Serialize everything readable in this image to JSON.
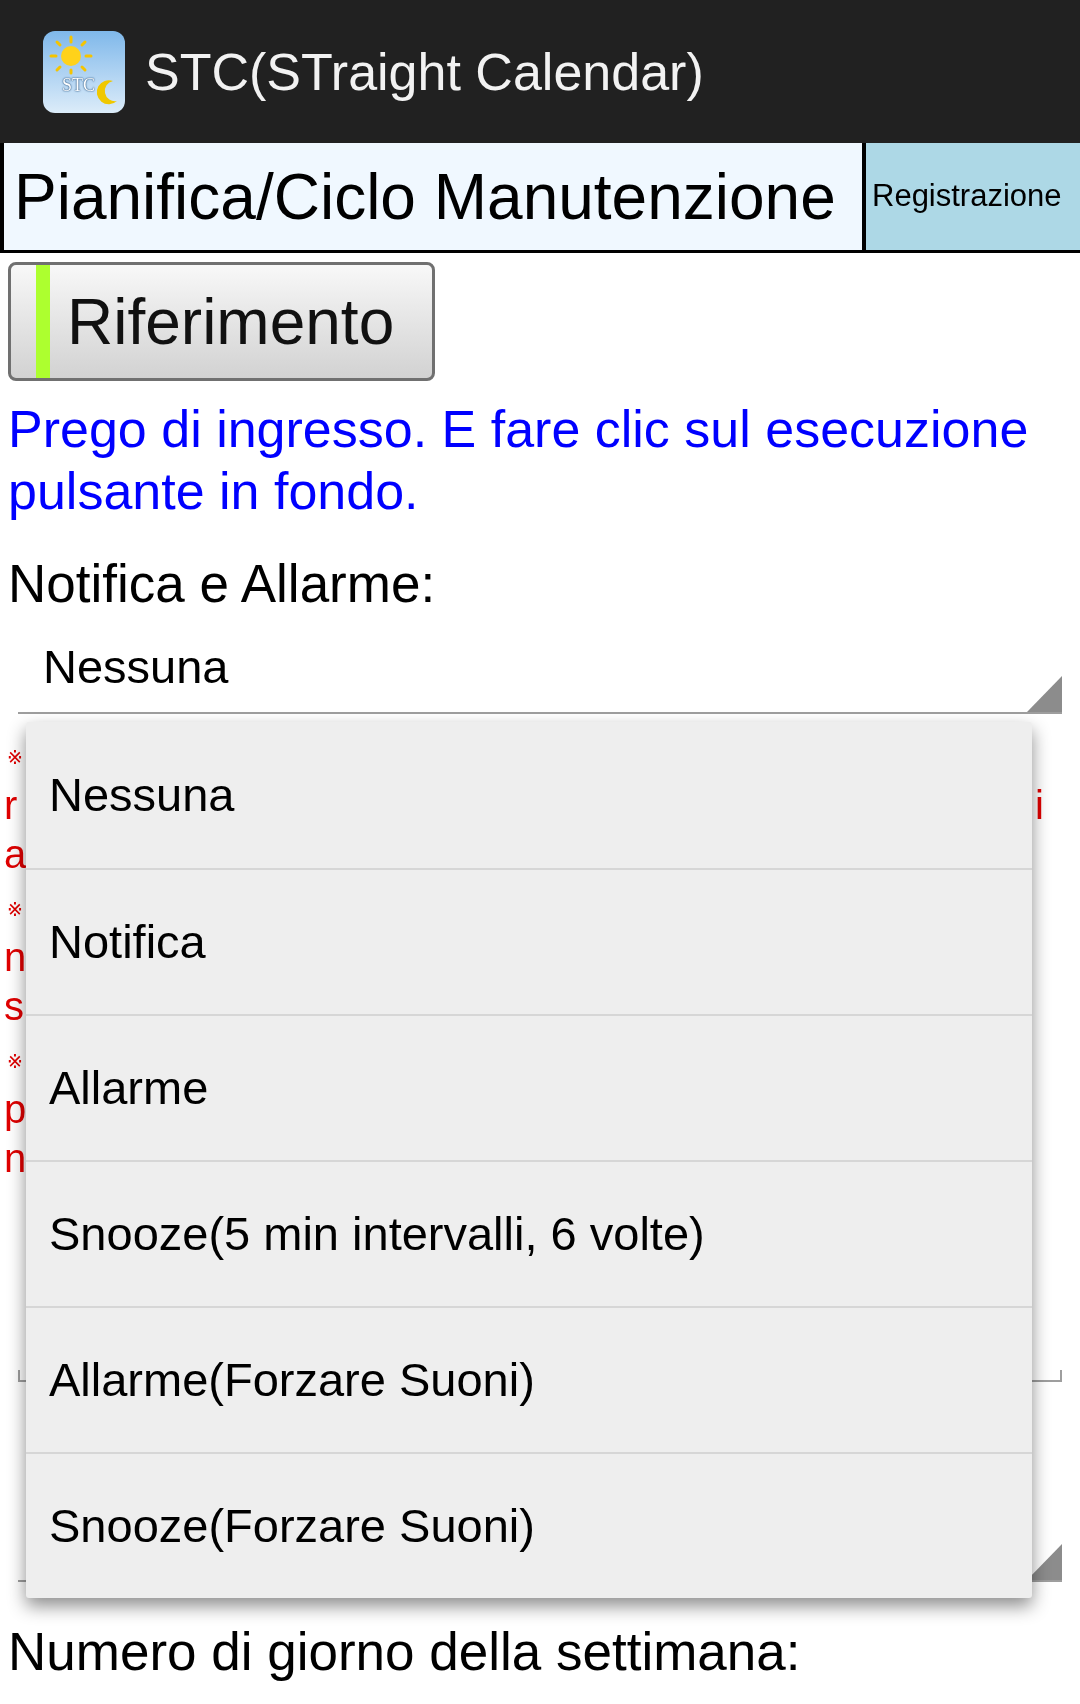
{
  "app_bar": {
    "title": "STC(STraight Calendar)",
    "logo_text": "STC"
  },
  "tabs": [
    {
      "label": "Pianifica/Ciclo Manutenzione",
      "selected": true
    },
    {
      "label": "Registrazione",
      "selected": false
    }
  ],
  "reference_button": {
    "label": "Riferimento"
  },
  "instruction": "Prego di ingresso. E fare clic sul esecuzione pulsante in fondo.",
  "form": [
    {
      "kind": "spinner",
      "label": "Notifica e Allarme:",
      "value": "Nessuna"
    },
    {
      "kind": "notes",
      "notes": [
        {
          "mark": "※",
          "lines": [
            {
              "start": "r",
              "end": "i"
            },
            {
              "start": "a"
            }
          ]
        },
        {
          "mark": "※",
          "lines": [
            {
              "start": "n"
            },
            {
              "start": "s"
            }
          ]
        },
        {
          "mark": "※",
          "lines": [
            {
              "start": "p"
            },
            {
              "start": "n"
            }
          ]
        }
      ]
    },
    {
      "kind": "text_field"
    },
    {
      "kind": "spinner"
    },
    {
      "kind": "label",
      "label": "Numero di giorno della settimana:"
    }
  ],
  "dropdown": {
    "options": [
      "Nessuna",
      "Notifica",
      "Allarme",
      "Snooze(5 min intervalli, 6 volte)",
      "Allarme(Forzare Suoni)",
      "Snooze(Forzare Suoni)"
    ]
  }
}
